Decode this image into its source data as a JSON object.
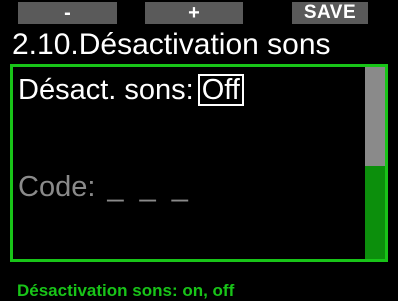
{
  "softkeys": {
    "left": "-",
    "middle": "+",
    "right": "SAVE"
  },
  "title": "2.10.Désactivation sons",
  "setting": {
    "label": "Désact. sons:",
    "value": "Off"
  },
  "code": {
    "label": "Code:",
    "value": "_ _ _"
  },
  "scroll_position": 0.5,
  "status": "Désactivation sons: on, off",
  "colors": {
    "accent_green": "#18c418",
    "softkey_bg": "#5a5a5a",
    "inactive_text": "#8a8a8a",
    "background": "#000000"
  }
}
